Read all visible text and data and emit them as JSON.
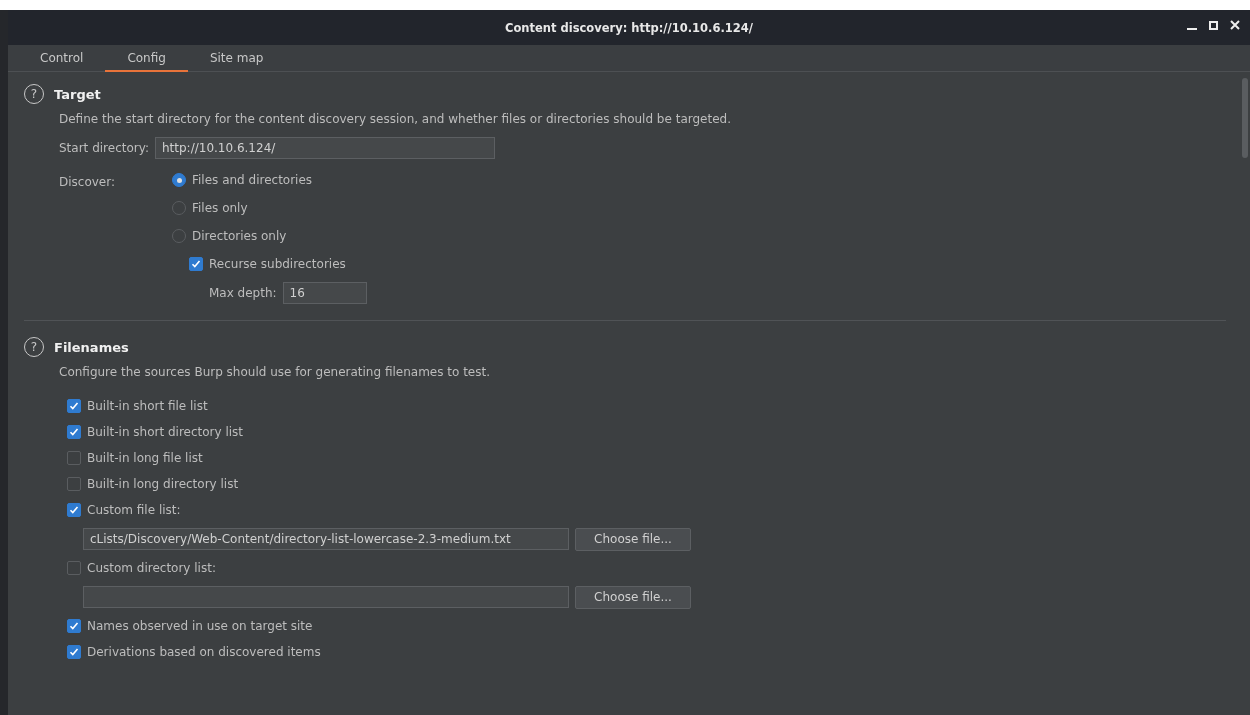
{
  "window": {
    "title": "Content discovery: http://10.10.6.124/"
  },
  "tabs": [
    {
      "label": "Control",
      "selected": false
    },
    {
      "label": "Config",
      "selected": true
    },
    {
      "label": "Site map",
      "selected": false
    }
  ],
  "target": {
    "help": "?",
    "title": "Target",
    "description": "Define the start directory for the content discovery session, and whether files or directories should be targeted.",
    "start_label": "Start directory:",
    "start_value": "http://10.10.6.124/",
    "discover_label": "Discover:",
    "options": [
      {
        "label": "Files and directories",
        "selected": true
      },
      {
        "label": "Files only",
        "selected": false
      },
      {
        "label": "Directories only",
        "selected": false
      }
    ],
    "recurse": {
      "label": "Recurse subdirectories",
      "checked": true
    },
    "depth_label": "Max depth:",
    "depth_value": "16"
  },
  "filenames": {
    "help": "?",
    "title": "Filenames",
    "description": "Configure the sources Burp should use for generating filenames to test.",
    "items": [
      {
        "kind": "checkbox",
        "label": "Built-in short file list",
        "checked": true
      },
      {
        "kind": "checkbox",
        "label": "Built-in short directory list",
        "checked": true
      },
      {
        "kind": "checkbox",
        "label": "Built-in long file list",
        "checked": false
      },
      {
        "kind": "checkbox",
        "label": "Built-in long directory list",
        "checked": false
      },
      {
        "kind": "checkbox",
        "label": "Custom file list:",
        "checked": true
      },
      {
        "kind": "file",
        "value": "cLists/Discovery/Web-Content/directory-list-lowercase-2.3-medium.txt",
        "button": "Choose file..."
      },
      {
        "kind": "checkbox",
        "label": "Custom directory list:",
        "checked": false
      },
      {
        "kind": "file",
        "button": "Choose file..."
      },
      {
        "kind": "checkbox",
        "label": "Names observed in use on target site",
        "checked": true
      },
      {
        "kind": "checkbox",
        "label": "Derivations based on discovered items",
        "checked": true
      }
    ]
  }
}
